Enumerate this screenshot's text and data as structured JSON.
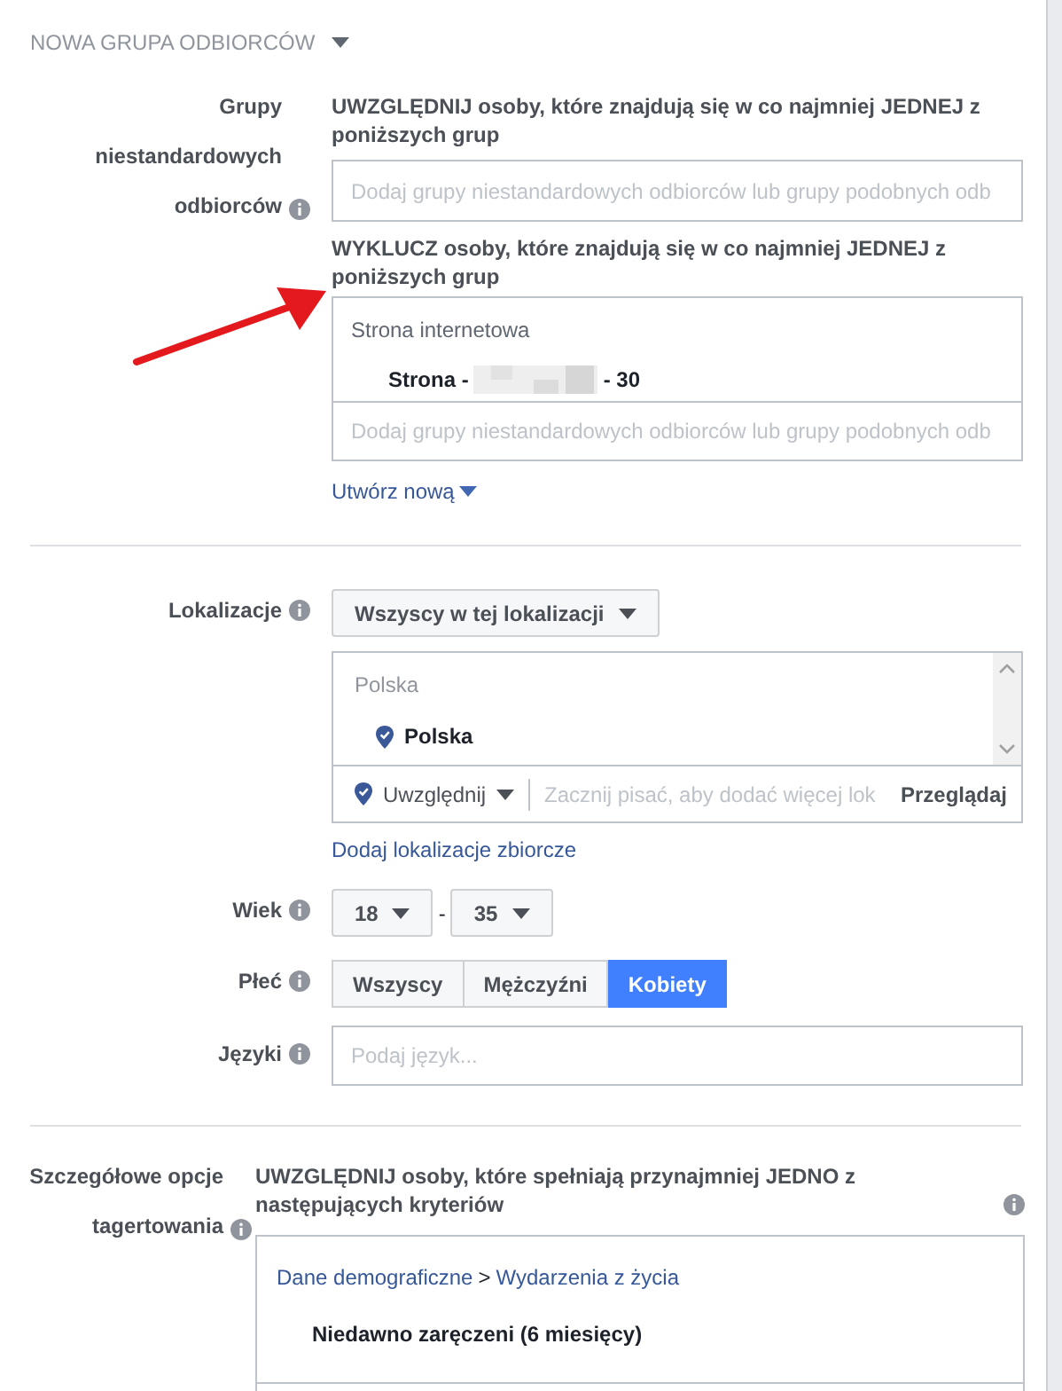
{
  "header": {
    "title": "NOWA GRUPA ODBIORCÓW",
    "expanded": true
  },
  "custom_audiences": {
    "label": "Grupy niestandardowych odbiorców",
    "include": {
      "text": "UWZGLĘDNIJ osoby, które znajdują się w co najmniej JEDNEJ z poniższych grup",
      "placeholder": "Dodaj grupy niestandardowych odbiorców lub grupy podobnych odb"
    },
    "exclude": {
      "text": "WYKLUCZ osoby, które znajdują się w co najmniej JEDNEJ z poniższych grup",
      "category": "Strona internetowa",
      "item_before": "Strona -",
      "item_after": "- 30",
      "placeholder": "Dodaj grupy niestandardowych odbiorców lub grupy podobnych odb"
    },
    "create_link": "Utwórz nową"
  },
  "locations": {
    "label": "Lokalizacje",
    "mode": "Wszyscy w tej lokalizacji",
    "group": "Polska",
    "item": "Polska",
    "include_mode": "Uwzględnij",
    "placeholder": "Zacznij pisać, aby dodać więcej lok",
    "browse": "Przeglądaj",
    "bulk_link": "Dodaj lokalizacje zbiorcze"
  },
  "age": {
    "label": "Wiek",
    "from": "18",
    "separator": "-",
    "to": "35"
  },
  "gender": {
    "label": "Płeć",
    "options": [
      {
        "label": "Wszyscy",
        "selected": false
      },
      {
        "label": "Mężczyźni",
        "selected": false
      },
      {
        "label": "Kobiety",
        "selected": true
      }
    ]
  },
  "languages": {
    "label": "Języki",
    "placeholder": "Podaj język..."
  },
  "detailed": {
    "label": "Szczegółowe opcje tagertowania",
    "text": "UWZGLĘDNIJ osoby, które spełniają przynajmniej JEDNO z następujących kryteriów",
    "path": [
      "Dane demograficzne",
      "Wydarzenia z życia"
    ],
    "path_separator": ">",
    "item": "Niedawno zaręczeni (6 miesięcy)"
  }
}
